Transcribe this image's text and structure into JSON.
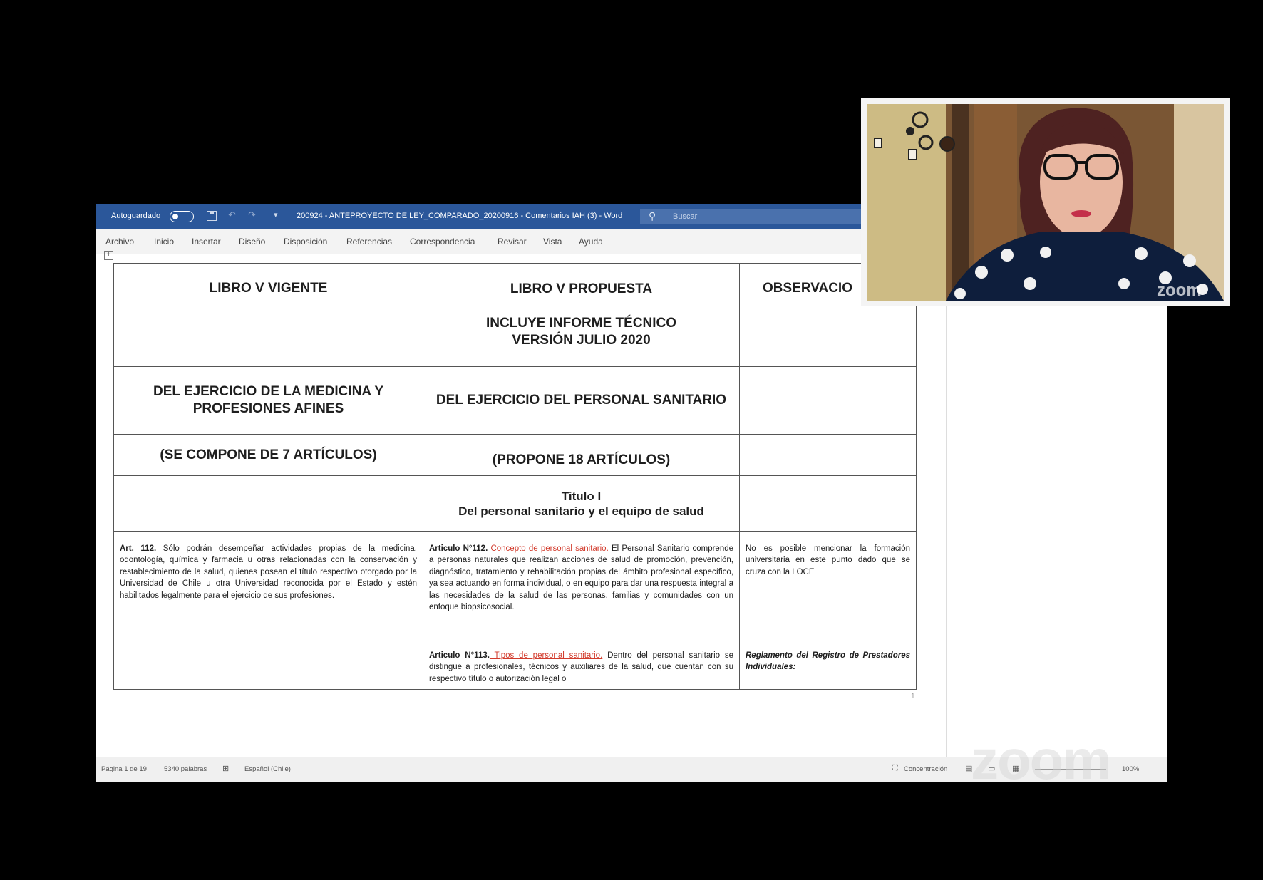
{
  "word": {
    "autosave_label": "Autoguardado",
    "doc_title": "200924 - ANTEPROYECTO DE LEY_COMPARADO_20200916 - Comentarios IAH (3) - Word",
    "search_placeholder": "Buscar",
    "menu": [
      "Archivo",
      "Inicio",
      "Insertar",
      "Diseño",
      "Disposición",
      "Referencias",
      "Correspondencia",
      "Revisar",
      "Vista",
      "Ayuda"
    ],
    "status": {
      "page": "Página 1 de 19",
      "words": "5340 palabras",
      "language": "Español (Chile)",
      "focus": "Concentración",
      "zoom": "100%"
    },
    "page_mark": "1"
  },
  "table": {
    "headers": {
      "col1": "LIBRO V VIGENTE",
      "col2_title": "LIBRO V PROPUESTA",
      "col2_sub1": "INCLUYE INFORME TÉCNICO",
      "col2_sub2": "VERSIÓN JULIO 2020",
      "col3": "OBSERVACIO"
    },
    "row2": {
      "col1": "DEL EJERCICIO DE LA MEDICINA Y PROFESIONES AFINES",
      "col2": "DEL EJERCICIO DEL PERSONAL SANITARIO"
    },
    "row3": {
      "col1": "(SE COMPONE DE 7 ARTÍCULOS)",
      "col2": "(PROPONE 18 ARTÍCULOS)"
    },
    "row4": {
      "line1": "Titulo I",
      "line2": "Del personal sanitario y el equipo de salud"
    },
    "row5": {
      "col1_lead": "Art. 112.",
      "col1_text": " Sólo podrán desempeñar actividades propias de la medicina, odontología, química y farmacia u otras relacionadas con la conservación y restablecimiento de la salud, quienes posean el título respectivo otorgado por la Universidad de Chile u otra Universidad reconocida por el Estado y estén habilitados legalmente para el ejercicio de sus profesiones.",
      "col2_lead": "Articulo N°112.",
      "col2_red": " Concepto de personal sanitario.",
      "col2_text": " El Personal Sanitario comprende a personas naturales que realizan acciones de salud de promoción, prevención, diagnóstico, tratamiento y rehabilitación propias del ámbito profesional específico, ya sea actuando en forma individual, o en equipo para dar una respuesta integral a las necesidades de la salud de las personas, familias y comunidades con un enfoque biopsicosocial.",
      "col3_text": "No es posible mencionar la formación universitaria en este punto dado que se cruza con la LOCE"
    },
    "row6": {
      "col2_lead": "Articulo N°113.",
      "col2_red": " Tipos de personal sanitario.",
      "col2_text": " Dentro del personal sanitario se distingue a profesionales, técnicos y auxiliares de la salud, que cuentan con su respectivo título o autorización legal o",
      "col3_text": "Reglamento del Registro de Prestadores Individuales:"
    }
  },
  "overlay": {
    "watermark": "zoom",
    "video_watermark": "zoom"
  }
}
